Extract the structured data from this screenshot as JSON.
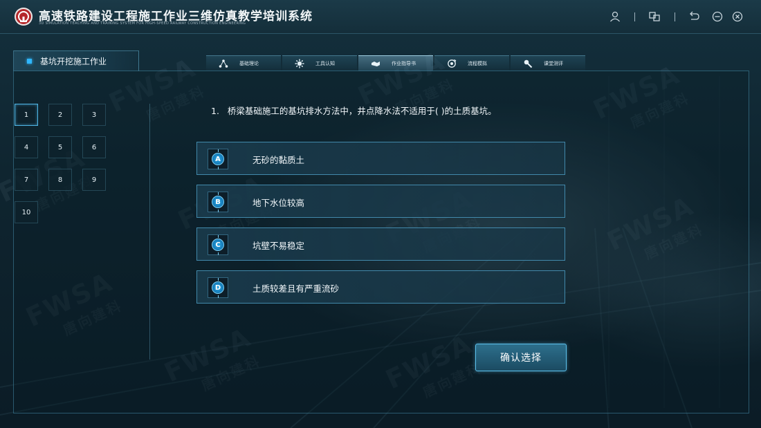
{
  "app": {
    "title": "高速铁路建设工程施工作业三维仿真教学培训系统",
    "subtitle": "3D SIMULATION TEACHING AND TRAINING SYSTEM FOR HIGH-SPEED RAILWAY CONSTRUCTION ENGINEERING"
  },
  "toolbar": {
    "icons": [
      "user-icon",
      "window-switch-icon",
      "back-icon",
      "minimize-icon",
      "close-icon"
    ]
  },
  "section": {
    "label": "基坑开挖施工作业"
  },
  "nav_tabs": [
    {
      "label": "基础理论",
      "icon": "network-icon",
      "active": false
    },
    {
      "label": "工具认知",
      "icon": "gear-icon",
      "active": false
    },
    {
      "label": "作业指导书",
      "icon": "handshake-icon",
      "active": true
    },
    {
      "label": "流程模拟",
      "icon": "cycle-icon",
      "active": false
    },
    {
      "label": "课堂测评",
      "icon": "pen-icon",
      "active": false
    }
  ],
  "question_numbers": [
    "1",
    "2",
    "3",
    "4",
    "5",
    "6",
    "7",
    "8",
    "9",
    "10"
  ],
  "current_question": "1",
  "question": {
    "number": "1.",
    "text": "桥梁基础施工的基坑排水方法中，井点降水法不适用于( )的土质基坑。"
  },
  "options": [
    {
      "letter": "A",
      "text": "无砂的黏质土"
    },
    {
      "letter": "B",
      "text": "地下水位较高"
    },
    {
      "letter": "C",
      "text": "坑壁不易稳定"
    },
    {
      "letter": "D",
      "text": "土质较差且有严重流砂"
    }
  ],
  "confirm_label": "确认选择",
  "watermark": {
    "latin": "FWSA",
    "cn": "唐向建科"
  },
  "colors": {
    "accent": "#2fb7ff",
    "frame": "#468caa",
    "badge": "#1478b4"
  }
}
